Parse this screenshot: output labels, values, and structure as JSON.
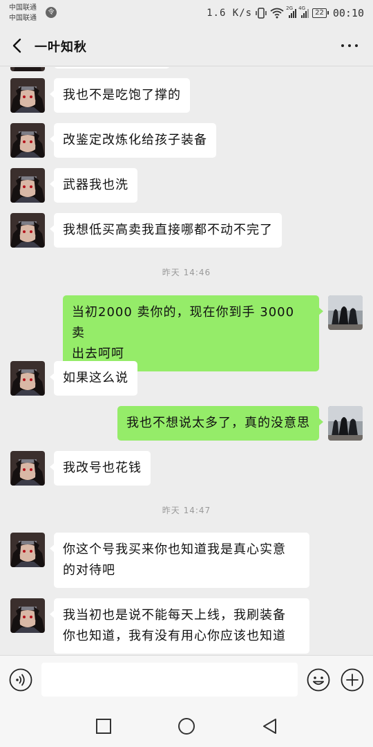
{
  "status_bar": {
    "carrier_1": "中国联通",
    "carrier_2": "中国联通",
    "net_speed": "1.6 K/s",
    "sim1_tag": "2G",
    "sim2_tag": "4G",
    "battery": "22",
    "time": "00:10"
  },
  "header": {
    "title": "一叶知秋"
  },
  "messages": [
    {
      "side": "in",
      "text": "我也不是吃饱了撑的"
    },
    {
      "side": "in",
      "text": "改鉴定改炼化给孩子装备"
    },
    {
      "side": "in",
      "text": "武器我也洗"
    },
    {
      "side": "in",
      "text": "我想低买高卖我直接哪都不动不完了"
    },
    {
      "timestamp": "昨天 14:46"
    },
    {
      "side": "out",
      "line1": "当初2000 卖你的，现在你到手 3000 卖",
      "line2": "出去呵呵"
    },
    {
      "side": "in",
      "text": "如果这么说"
    },
    {
      "side": "out",
      "text": "我也不想说太多了，真的没意思"
    },
    {
      "side": "in",
      "text": "我改号也花钱"
    },
    {
      "timestamp": "昨天 14:47"
    },
    {
      "side": "in",
      "line1": "你这个号我买来你也知道我是真心实意",
      "line2": "的对待吧"
    },
    {
      "side": "in",
      "line1": "我当初也是说不能每天上线，我刷装备",
      "line2": "你也知道，我有没有用心你应该也知道"
    }
  ],
  "input_bar": {
    "placeholder": ""
  },
  "colors": {
    "background": "#ededed",
    "outgoing_bubble": "#95ec69",
    "incoming_bubble": "#ffffff"
  },
  "icons": {
    "back": "chevron-left-icon",
    "more": "more-dots-icon",
    "voice": "voice-icon",
    "emoji": "emoji-icon",
    "plus": "plus-icon",
    "nav_recent": "square-icon",
    "nav_home": "circle-icon",
    "nav_back": "triangle-back-icon"
  }
}
